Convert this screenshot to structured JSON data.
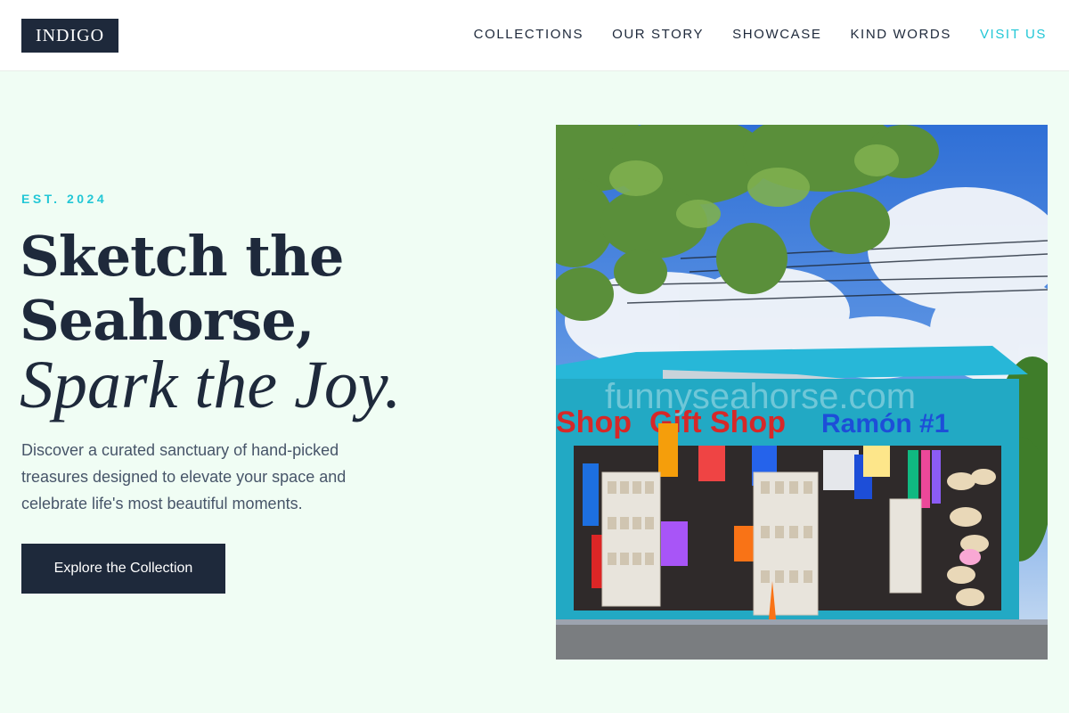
{
  "header": {
    "logo": "INDIGO",
    "nav": [
      {
        "label": "COLLECTIONS"
      },
      {
        "label": "OUR STORY"
      },
      {
        "label": "SHOWCASE"
      },
      {
        "label": "KIND WORDS"
      },
      {
        "label": "VISIT US"
      }
    ]
  },
  "hero": {
    "eyebrow": "EST. 2024",
    "headline_line1": "Sketch the",
    "headline_line2": "Seahorse,",
    "headline_line3": "Spark the Joy.",
    "description": "Discover a curated sanctuary of hand-picked treasures designed to elevate your space and celebrate life's most beautiful moments.",
    "cta_label": "Explore the Collection",
    "image": {
      "sign_left": "Shop",
      "sign_center": "Gift Shop",
      "sign_right": "Ramón #1",
      "watermark": "funnyseahorse.com"
    }
  },
  "colors": {
    "background": "#f0fdf4",
    "navy": "#1e293b",
    "accent": "#22c7d6",
    "body_text": "#475569"
  }
}
